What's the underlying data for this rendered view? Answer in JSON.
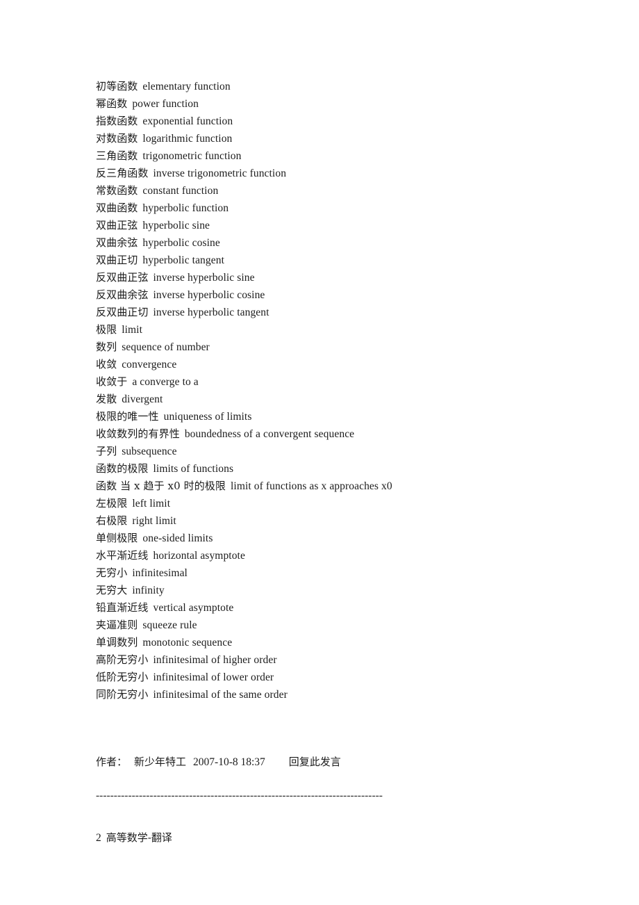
{
  "document": {
    "background_color": "#ffffff",
    "text_color": "#1c1c1c"
  },
  "glossary": {
    "entries": [
      {
        "cn": "初等函数",
        "en": "elementary function"
      },
      {
        "cn": "幂函数",
        "en": "power function"
      },
      {
        "cn": "指数函数",
        "en": "exponential function"
      },
      {
        "cn": "对数函数",
        "en": "logarithmic function"
      },
      {
        "cn": "三角函数",
        "en": "trigonometric function"
      },
      {
        "cn": "反三角函数",
        "en": "inverse trigonometric function"
      },
      {
        "cn": "常数函数",
        "en": "constant function"
      },
      {
        "cn": "双曲函数",
        "en": "hyperbolic function"
      },
      {
        "cn": "双曲正弦",
        "en": "hyperbolic sine"
      },
      {
        "cn": "双曲余弦",
        "en": "hyperbolic cosine"
      },
      {
        "cn": "双曲正切",
        "en": "hyperbolic tangent"
      },
      {
        "cn": "反双曲正弦",
        "en": "inverse hyperbolic sine"
      },
      {
        "cn": "反双曲余弦",
        "en": "inverse hyperbolic cosine"
      },
      {
        "cn": "反双曲正切",
        "en": "inverse hyperbolic tangent"
      },
      {
        "cn": "极限",
        "en": "limit"
      },
      {
        "cn": "数列",
        "en": "sequence of number"
      },
      {
        "cn": "收敛",
        "en": "convergence"
      },
      {
        "cn": "收敛于",
        "en": "a converge to a"
      },
      {
        "cn": "发散",
        "en": "divergent"
      },
      {
        "cn": "极限的唯一性",
        "en": "uniqueness of limits"
      },
      {
        "cn": "收敛数列的有界性",
        "en": "boundedness of a convergent sequence"
      },
      {
        "cn": "子列",
        "en": "subsequence"
      },
      {
        "cn": "函数的极限",
        "en": "limits of functions"
      },
      {
        "cn": "函数 当 x 趋于 x0 时的极限",
        "en": "limit of functions as x approaches x0"
      },
      {
        "cn": "左极限",
        "en": "left limit"
      },
      {
        "cn": "右极限",
        "en": "right limit"
      },
      {
        "cn": "单侧极限",
        "en": "one-sided limits"
      },
      {
        "cn": "水平渐近线",
        "en": "horizontal asymptote"
      },
      {
        "cn": "无穷小",
        "en": "infinitesimal"
      },
      {
        "cn": "无穷大",
        "en": "infinity"
      },
      {
        "cn": "铅直渐近线",
        "en": "vertical asymptote"
      },
      {
        "cn": "夹逼准则",
        "en": "squeeze rule"
      },
      {
        "cn": "单调数列",
        "en": "monotonic sequence"
      },
      {
        "cn": "高阶无穷小",
        "en": "infinitesimal of higher order"
      },
      {
        "cn": "低阶无穷小",
        "en": "infinitesimal of lower order"
      },
      {
        "cn": "同阶无穷小",
        "en": "infinitesimal of the same order"
      }
    ]
  },
  "post_meta": {
    "author_label": "作者：",
    "author_name": "新少年特工",
    "timestamp": "2007-10-8 18:37",
    "reply_link": "回复此发言"
  },
  "separator": {
    "text": "--------------------------------------------------------------------------------"
  },
  "next_post": {
    "number": "2",
    "title": "高等数学-翻译"
  }
}
